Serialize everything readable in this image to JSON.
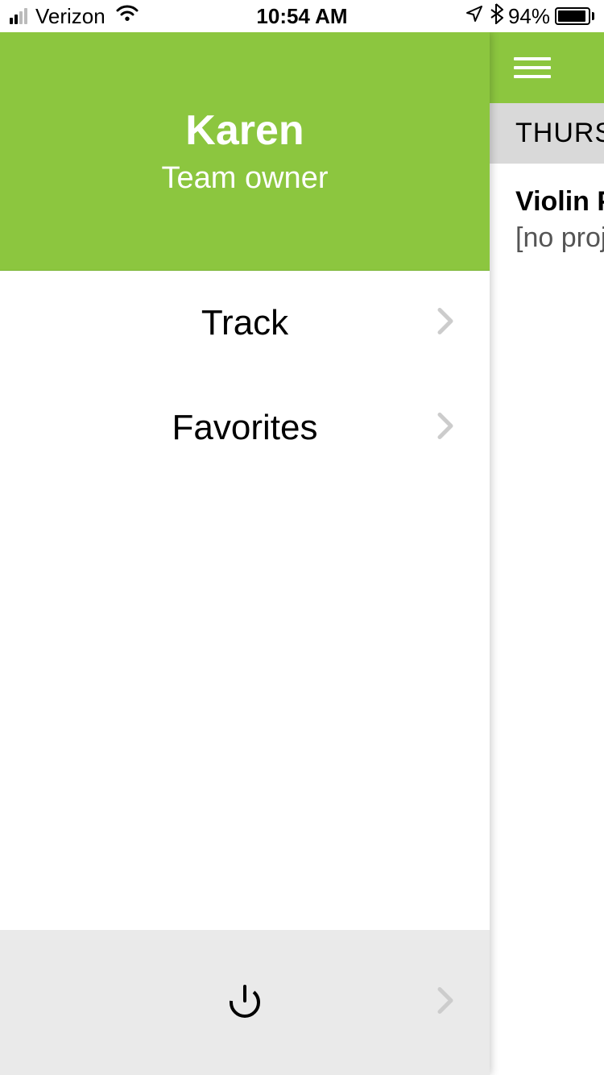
{
  "status_bar": {
    "carrier": "Verizon",
    "time": "10:54 AM",
    "battery_pct": "94%"
  },
  "sidebar": {
    "user_name": "Karen",
    "user_role": "Team owner",
    "menu": [
      {
        "label": "Track"
      },
      {
        "label": "Favorites"
      }
    ]
  },
  "underlay": {
    "day_header": "THURS",
    "item_title": "Violin Pr",
    "item_subtitle": "[no proje"
  },
  "colors": {
    "accent": "#8CC63F"
  }
}
